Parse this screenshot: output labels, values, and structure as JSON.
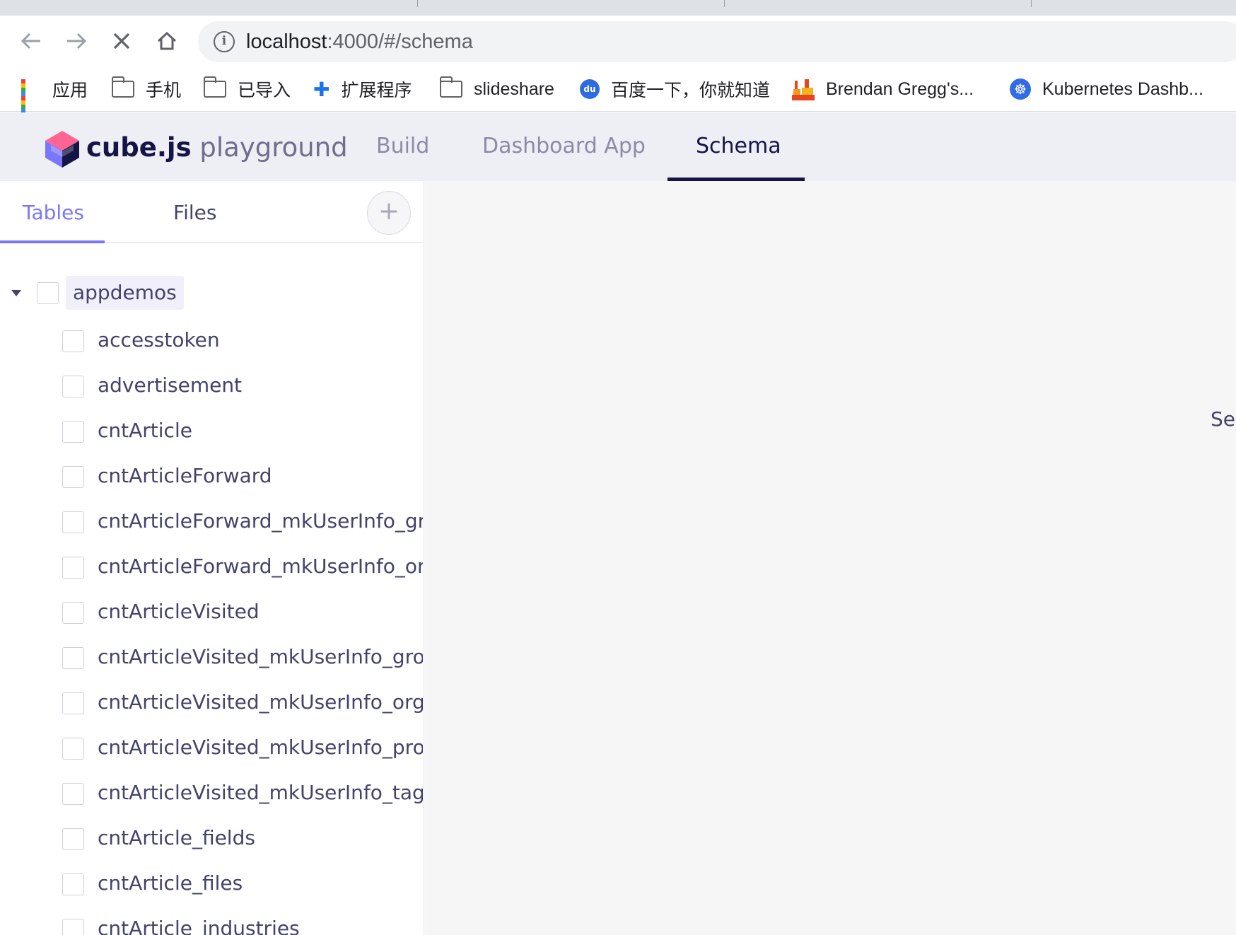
{
  "browser": {
    "url_host": "localhost",
    "url_rest": ":4000/#/schema",
    "icons": {
      "back": "back-arrow-icon",
      "forward": "forward-arrow-icon",
      "stop": "close-icon",
      "home": "home-icon",
      "info": "info-icon"
    },
    "bookmarks": [
      {
        "label": "应用",
        "icon": "apps-grid-icon"
      },
      {
        "label": "手机",
        "icon": "folder-icon"
      },
      {
        "label": "已导入",
        "icon": "folder-icon"
      },
      {
        "label": "扩展程序",
        "icon": "puzzle-icon"
      },
      {
        "label": "slideshare",
        "icon": "folder-icon"
      },
      {
        "label": "百度一下，你就知道",
        "icon": "baidu-paw-icon"
      },
      {
        "label": "Brendan Gregg's...",
        "icon": "flame-graph-icon"
      },
      {
        "label": "Kubernetes Dashb...",
        "icon": "kubernetes-icon"
      }
    ]
  },
  "app": {
    "brand_bold": "cube.js",
    "brand_light": " playground",
    "tabs": [
      {
        "label": "Build"
      },
      {
        "label": "Dashboard App"
      },
      {
        "label": "Schema"
      }
    ],
    "active_tab": "Schema",
    "accent": "#7a77ff",
    "header_bg": "#eeeef5"
  },
  "sidebar": {
    "tabs": [
      {
        "label": "Tables"
      },
      {
        "label": "Files"
      }
    ],
    "active_tab": "Tables",
    "add_symbol": "+",
    "tree": {
      "root": "appdemos",
      "tables": [
        "accesstoken",
        "advertisement",
        "cntArticle",
        "cntArticleForward",
        "cntArticleForward_mkUserInfo_grou",
        "cntArticleForward_mkUserInfo_org_",
        "cntArticleVisited",
        "cntArticleVisited_mkUserInfo_group",
        "cntArticleVisited_mkUserInfo_org_",
        "cntArticleVisited_mkUserInfo_profe",
        "cntArticleVisited_mkUserInfo_tag_",
        "cntArticle_fields",
        "cntArticle_files",
        "cntArticle_industries"
      ]
    }
  },
  "main": {
    "hint_text": "Sel"
  }
}
